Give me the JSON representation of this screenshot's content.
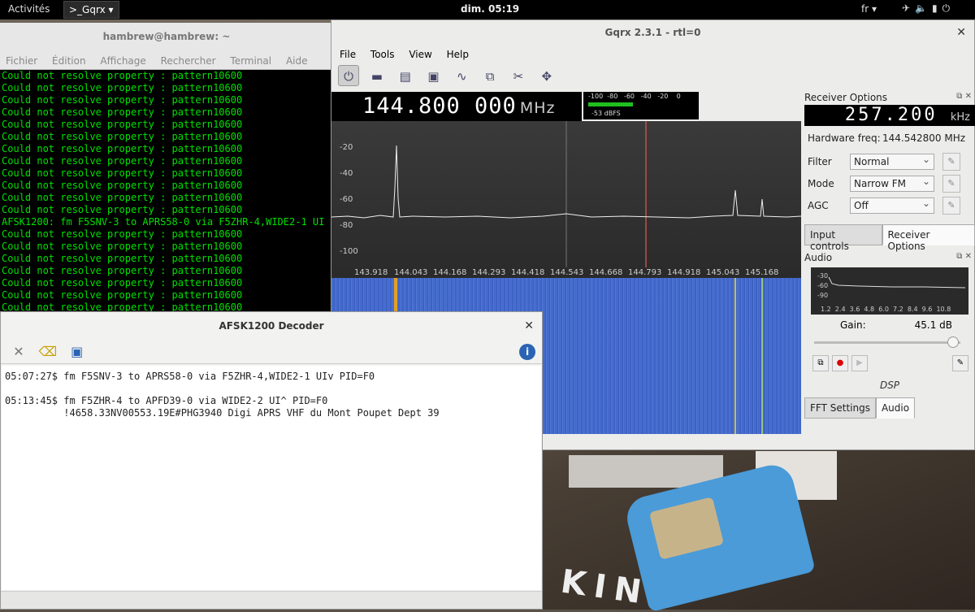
{
  "topbar": {
    "activities": "Activités",
    "app": ">_Gqrx ▾",
    "clock": "dim. 05:19",
    "lang": "fr ▾"
  },
  "terminal": {
    "title": "hambrew@hambrew: ~",
    "menu": [
      "Fichier",
      "Édition",
      "Affichage",
      "Rechercher",
      "Terminal",
      "Aide"
    ],
    "lines": [
      "Could not resolve property : pattern10600",
      "Could not resolve property : pattern10600",
      "Could not resolve property : pattern10600",
      "Could not resolve property : pattern10600",
      "Could not resolve property : pattern10600",
      "Could not resolve property : pattern10600",
      "Could not resolve property : pattern10600",
      "Could not resolve property : pattern10600",
      "Could not resolve property : pattern10600",
      "Could not resolve property : pattern10600",
      "Could not resolve property : pattern10600",
      "Could not resolve property : pattern10600",
      "AFSK1200: fm F5SNV-3 to APRS58-0 via F5ZHR-4,WIDE2-1 UI",
      "Could not resolve property : pattern10600",
      "Could not resolve property : pattern10600",
      "Could not resolve property : pattern10600",
      "Could not resolve property : pattern10600",
      "Could not resolve property : pattern10600",
      "Could not resolve property : pattern10600",
      "Could not resolve property : pattern10600"
    ]
  },
  "gqrx": {
    "title": "Gqrx 2.3.1 - rtl=0",
    "menu": [
      "File",
      "Tools",
      "View",
      "Help"
    ],
    "freq": "144.800 000",
    "freq_unit": "MHz",
    "meter_scale": "-100  -80   -60   -40   -20    0",
    "meter_readout": "-53 dBFS",
    "y_labels": [
      "-20",
      "-40",
      "-60",
      "-80",
      "-100"
    ],
    "x_labels": [
      "143.918",
      "144.043",
      "144.168",
      "144.293",
      "144.418",
      "144.543",
      "144.668",
      "144.793",
      "144.918",
      "145.043",
      "145.168"
    ]
  },
  "receiver": {
    "title": "Receiver Options",
    "offset": "257.200",
    "offset_unit": "kHz",
    "hw_label": "Hardware freq:",
    "hw_value": "144.542800 MHz",
    "filter_label": "Filter",
    "filter_value": "Normal",
    "mode_label": "Mode",
    "mode_value": "Narrow FM",
    "agc_label": "AGC",
    "agc_value": "Off",
    "tab_input": "Input controls",
    "tab_receiver": "Receiver Options"
  },
  "audio": {
    "title": "Audio",
    "levels": [
      "-30",
      "-60",
      "-90"
    ],
    "xaxis": "1.2  2.4  3.6  4.8  6.0  7.2  8.4  9.6  10.8",
    "gain_label": "Gain:",
    "gain_value": "45.1 dB",
    "gain_fraction": 0.95,
    "dsp": "DSP",
    "tab_fft": "FFT Settings",
    "tab_audio": "Audio"
  },
  "decoder": {
    "title": "AFSK1200 Decoder",
    "log": "05:07:27$ fm F5SNV-3 to APRS58-0 via F5ZHR-4,WIDE2-1 UIv PID=F0\n\n05:13:45$ fm F5ZHR-4 to APFD39-0 via WIDE2-2 UI^ PID=F0\n          !4658.33NV00553.19E#PHG3940 Digi APRS VHF du Mont Poupet Dept 39"
  },
  "desktop_text": "KIN"
}
